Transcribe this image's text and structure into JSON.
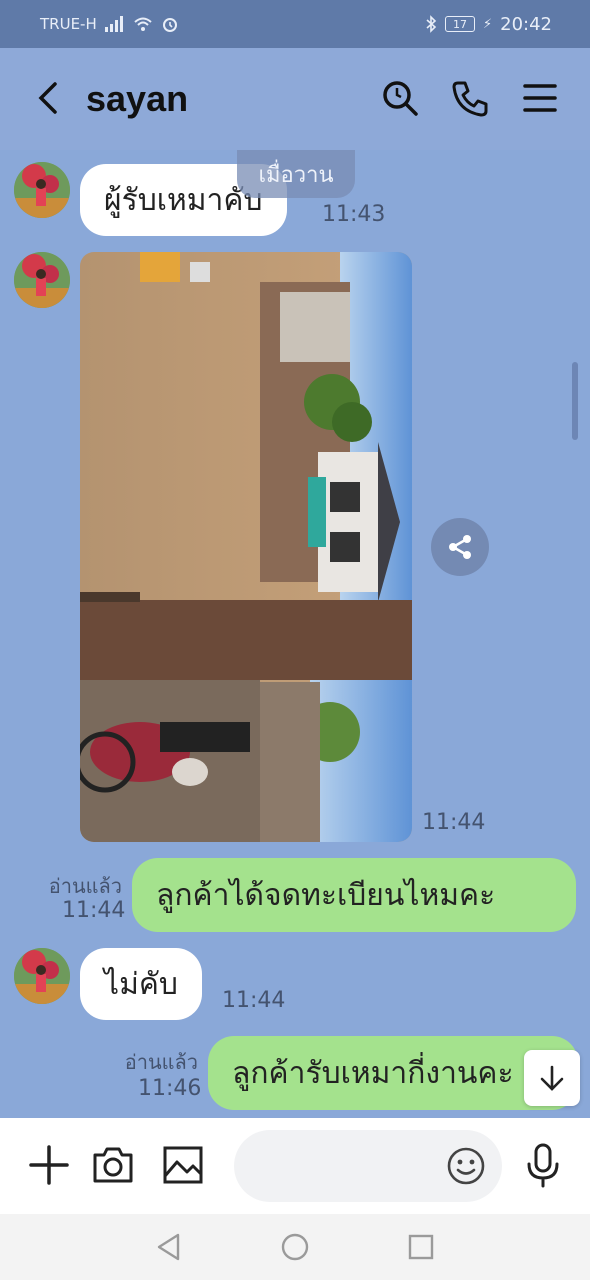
{
  "status": {
    "carrier": "TRUE-H",
    "battery": "17",
    "time": "20:42"
  },
  "header": {
    "title": "sayan"
  },
  "chat": {
    "date_chip": "เมื่อวาน",
    "messages": [
      {
        "side": "in",
        "text": "ผู้รับเหมาคับ",
        "time": "11:43"
      },
      {
        "side": "in",
        "type": "photo",
        "time": "11:44"
      },
      {
        "side": "out",
        "text": "ลูกค้าได้จดทะเบียนไหมคะ",
        "read": "อ่านแล้ว",
        "time": "11:44"
      },
      {
        "side": "in",
        "text": "ไม่คับ",
        "time": "11:44"
      },
      {
        "side": "out",
        "text": "ลูกค้ารับเหมากี่งานคะ",
        "read": "อ่านแล้ว",
        "time": "11:46"
      }
    ]
  },
  "input": {
    "placeholder": ""
  },
  "colors": {
    "chat_bg": "#8aa8d8",
    "status_bg": "#5f7aa8",
    "outgoing_bubble": "#a4e28d",
    "incoming_bubble": "#ffffff"
  },
  "icons": [
    "back-icon",
    "search-icon",
    "phone-icon",
    "menu-icon",
    "share-icon",
    "arrow-down-icon",
    "plus-icon",
    "camera-icon",
    "image-icon",
    "emoji-icon",
    "mic-icon"
  ]
}
